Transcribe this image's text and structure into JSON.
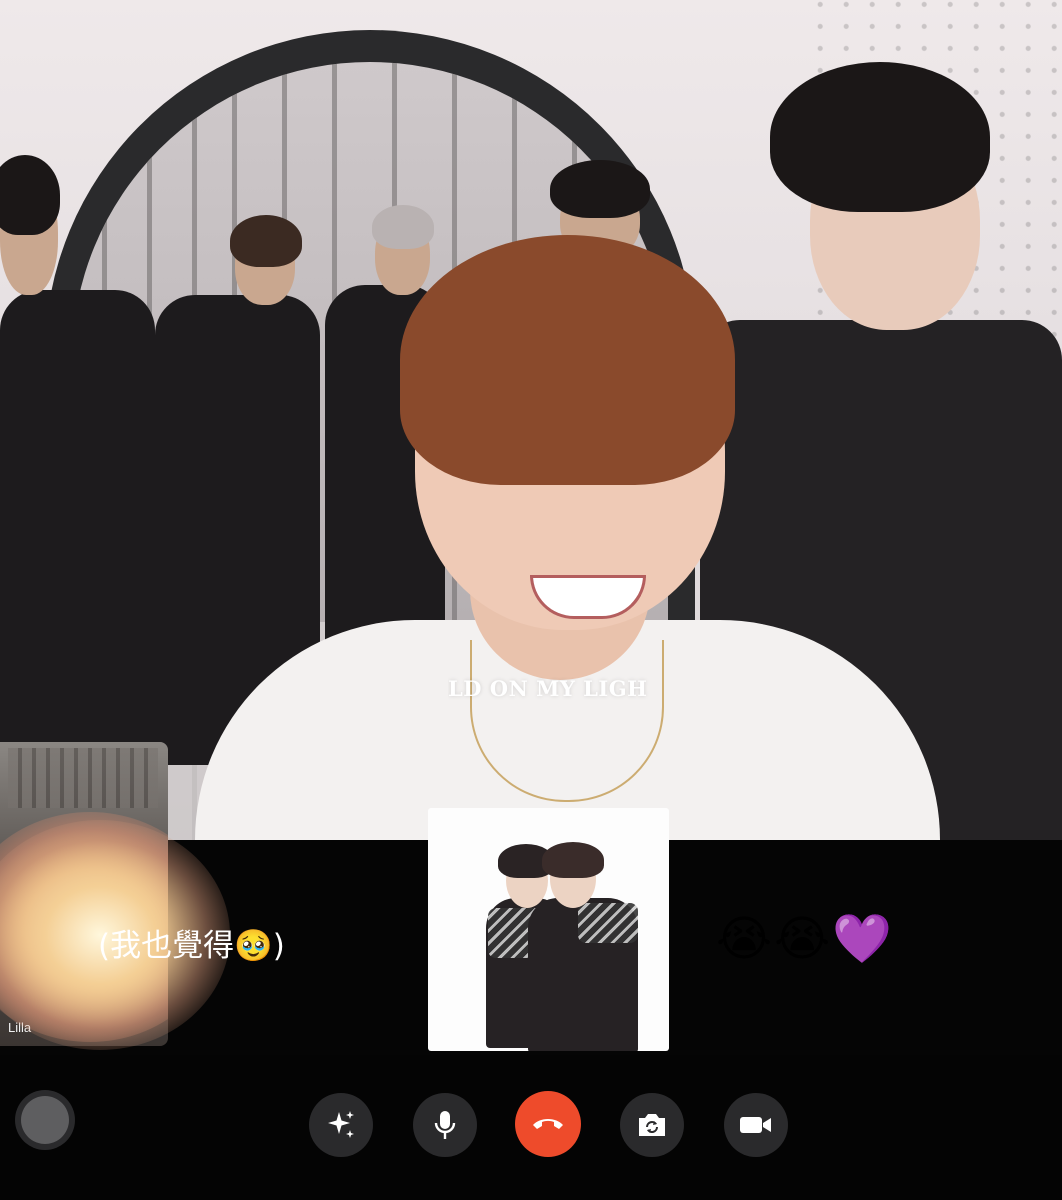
{
  "main_video": {
    "overlay_text": "LD ON MY LIGH"
  },
  "self_view": {
    "name": "Lilla"
  },
  "chat": {
    "left_message": "(我也覺得🥹)",
    "right_message": "😭😭💜"
  },
  "controls": {
    "effects_icon": "sparkles-icon",
    "mic_icon": "microphone-icon",
    "end_icon": "phone-hangup-icon",
    "flip_icon": "camera-flip-icon",
    "video_icon": "video-camera-icon"
  },
  "colors": {
    "end_call": "#ee4b2b",
    "control_bg": "#2a2a2c",
    "background": "#050505"
  }
}
